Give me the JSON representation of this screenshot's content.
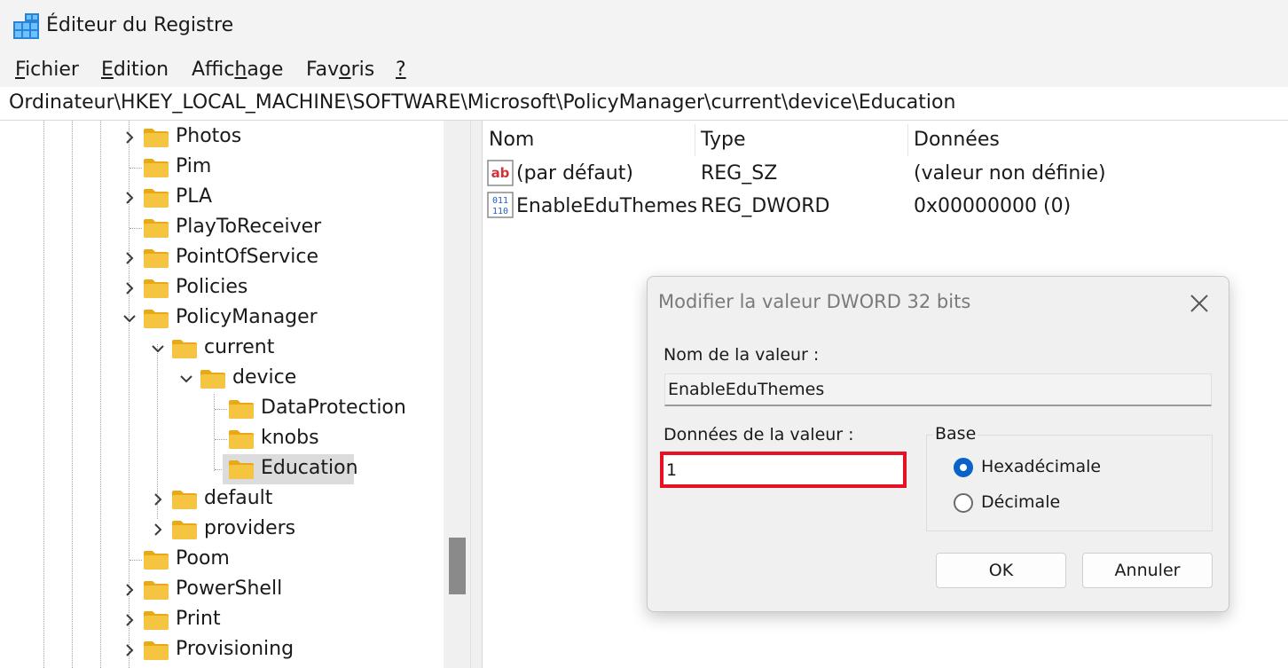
{
  "window": {
    "title": "Éditeur du Registre",
    "app_icon": "registry-editor-icon"
  },
  "menu": {
    "items": [
      {
        "access_key": "F",
        "rest": "ichier"
      },
      {
        "access_key": "E",
        "rest": "dition"
      },
      {
        "before": "Affic",
        "access_key": "h",
        "rest": "age"
      },
      {
        "before": "Fav",
        "access_key": "o",
        "rest": "ris"
      },
      {
        "access_key": "?",
        "rest": ""
      }
    ]
  },
  "address": {
    "path": "Ordinateur\\HKEY_LOCAL_MACHINE\\SOFTWARE\\Microsoft\\PolicyManager\\current\\device\\Education"
  },
  "tree": {
    "items": [
      {
        "label": "Photos",
        "expander": "collapsed"
      },
      {
        "label": "Pim",
        "expander": "none"
      },
      {
        "label": "PLA",
        "expander": "collapsed"
      },
      {
        "label": "PlayToReceiver",
        "expander": "none"
      },
      {
        "label": "PointOfService",
        "expander": "collapsed"
      },
      {
        "label": "Policies",
        "expander": "collapsed"
      },
      {
        "label": "PolicyManager",
        "expander": "expanded"
      },
      {
        "label": "current",
        "expander": "expanded"
      },
      {
        "label": "device",
        "expander": "expanded"
      },
      {
        "label": "DataProtection",
        "expander": "none"
      },
      {
        "label": "knobs",
        "expander": "none"
      },
      {
        "label": "Education",
        "expander": "none",
        "selected": true
      },
      {
        "label": "default",
        "expander": "collapsed"
      },
      {
        "label": "providers",
        "expander": "collapsed"
      },
      {
        "label": "Poom",
        "expander": "none"
      },
      {
        "label": "PowerShell",
        "expander": "collapsed"
      },
      {
        "label": "Print",
        "expander": "collapsed"
      },
      {
        "label": "Provisioning",
        "expander": "collapsed"
      }
    ]
  },
  "list": {
    "columns": {
      "name": "Nom",
      "type": "Type",
      "data": "Données"
    },
    "rows": [
      {
        "icon": "string-value-icon",
        "name": "(par défaut)",
        "type": "REG_SZ",
        "data": "(valeur non définie)"
      },
      {
        "icon": "binary-value-icon",
        "name": "EnableEduThemes",
        "type": "REG_DWORD",
        "data": "0x00000000 (0)"
      }
    ]
  },
  "dialog": {
    "title": "Modifier la valeur DWORD 32 bits",
    "value_name_label": "Nom de la valeur :",
    "value_name": "EnableEduThemes",
    "value_data_label": "Données de la valeur :",
    "value_data": "1",
    "base_label": "Base",
    "base_hex": "Hexadécimale",
    "base_dec": "Décimale",
    "base_selected": "hex",
    "ok": "OK",
    "cancel": "Annuler",
    "highlight_color": "#e81123"
  },
  "colors": {
    "accent": "#0a62c9",
    "folder": "#f5c542"
  }
}
